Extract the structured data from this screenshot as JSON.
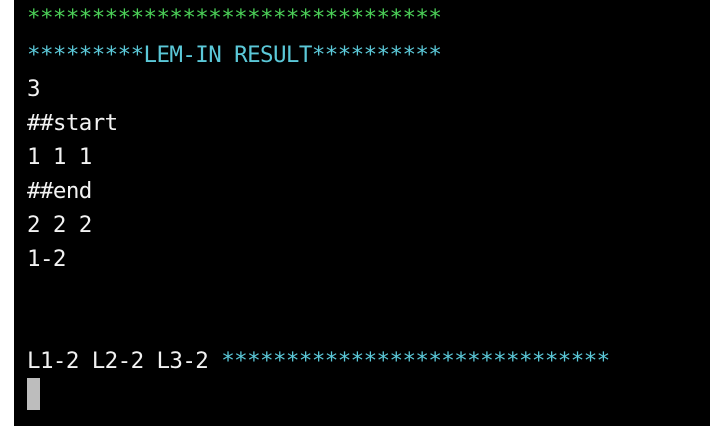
{
  "terminal": {
    "lines": [
      {
        "text": "********************************",
        "color": "#4bcf57"
      },
      {
        "text": "*********LEM-IN RESULT**********",
        "color": "#5bc8d8"
      },
      {
        "text": "3"
      },
      {
        "text": "##start"
      },
      {
        "text": "1 1 1"
      },
      {
        "text": "##end"
      },
      {
        "text": "2 2 2"
      },
      {
        "text": "1-2"
      },
      {
        "text": ""
      },
      {
        "text": ""
      }
    ],
    "result": {
      "moves": "L1-2 L2-2 L3-2 ",
      "stars": "******************************"
    }
  },
  "colors": {
    "background": "#000000",
    "text": "#f2f2f2",
    "green": "#4bcf57",
    "cyan": "#5bc8d8",
    "cursor": "#bdbdbd"
  }
}
